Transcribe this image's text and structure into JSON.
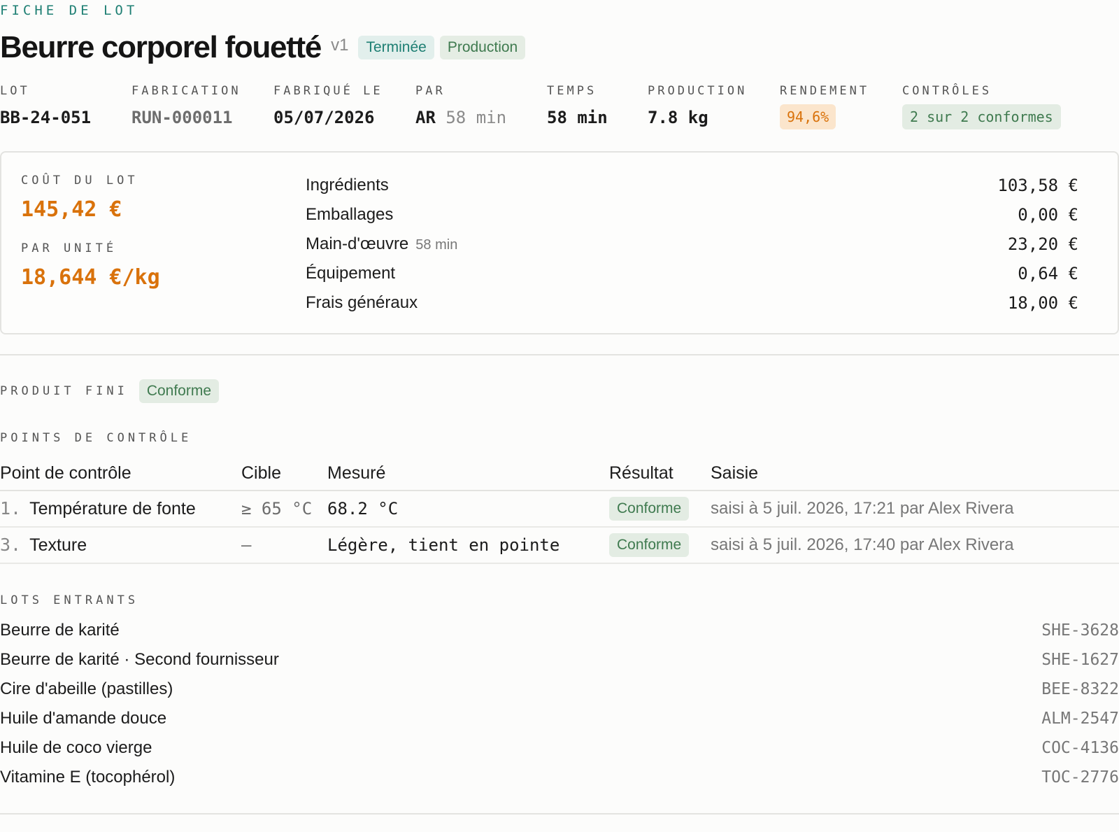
{
  "header": {
    "kicker": "FICHE DE LOT",
    "title": "Beurre corporel fouetté",
    "version": "v1",
    "status": "Terminée",
    "type": "Production"
  },
  "stats": {
    "lot": {
      "label": "LOT",
      "value": "BB-24-051"
    },
    "fabrication": {
      "label": "FABRICATION",
      "value": "RUN-000011"
    },
    "fabrique_le": {
      "label": "FABRIQUÉ LE",
      "value": "05/07/2026"
    },
    "par": {
      "label": "PAR",
      "value": "AR",
      "extra": "58 min"
    },
    "temps": {
      "label": "TEMPS",
      "value": "58 min"
    },
    "production": {
      "label": "PRODUCTION",
      "value": "7.8 kg"
    },
    "rendement": {
      "label": "RENDEMENT",
      "value": "94,6%"
    },
    "controles": {
      "label": "CONTRÔLES",
      "value": "2 sur 2 conformes"
    }
  },
  "cost": {
    "total_label": "COÛT DU LOT",
    "total_value": "145,42 €",
    "unit_label": "PAR UNITÉ",
    "unit_value": "18,644 €/kg",
    "lines": [
      {
        "label": "Ingrédients",
        "sub": "",
        "amount": "103,58 €"
      },
      {
        "label": "Emballages",
        "sub": "",
        "amount": "0,00 €"
      },
      {
        "label": "Main-d'œuvre",
        "sub": "58 min",
        "amount": "23,20 €"
      },
      {
        "label": "Équipement",
        "sub": "",
        "amount": "0,64 €"
      },
      {
        "label": "Frais généraux",
        "sub": "",
        "amount": "18,00 €"
      }
    ]
  },
  "produit_fini": {
    "label": "PRODUIT FINI",
    "status": "Conforme"
  },
  "checkpoints": {
    "label": "POINTS DE CONTRÔLE",
    "columns": [
      "Point de contrôle",
      "Cible",
      "Mesuré",
      "Résultat",
      "Saisie"
    ],
    "rows": [
      {
        "index": "1.",
        "name": "Température de fonte",
        "target": "≥ 65 °C",
        "measured": "68.2 °C",
        "result": "Conforme",
        "entry": "saisi à 5 juil. 2026, 17:21 par Alex Rivera"
      },
      {
        "index": "3.",
        "name": "Texture",
        "target": "—",
        "measured": "Légère, tient en pointe",
        "result": "Conforme",
        "entry": "saisi à 5 juil. 2026, 17:40 par Alex Rivera"
      }
    ]
  },
  "lots_entrants": {
    "label": "LOTS ENTRANTS",
    "items": [
      {
        "name": "Beurre de karité",
        "code": "SHE-3628"
      },
      {
        "name": "Beurre de karité · Second fournisseur",
        "code": "SHE-1627"
      },
      {
        "name": "Cire d'abeille (pastilles)",
        "code": "BEE-8322"
      },
      {
        "name": "Huile d'amande douce",
        "code": "ALM-2547"
      },
      {
        "name": "Huile de coco vierge",
        "code": "COC-4136"
      },
      {
        "name": "Vitamine E (tocophérol)",
        "code": "TOC-2776"
      }
    ]
  },
  "colors": {
    "accent_teal": "#1e7f73",
    "green": "#3f7a4f",
    "orange": "#d9720b"
  }
}
